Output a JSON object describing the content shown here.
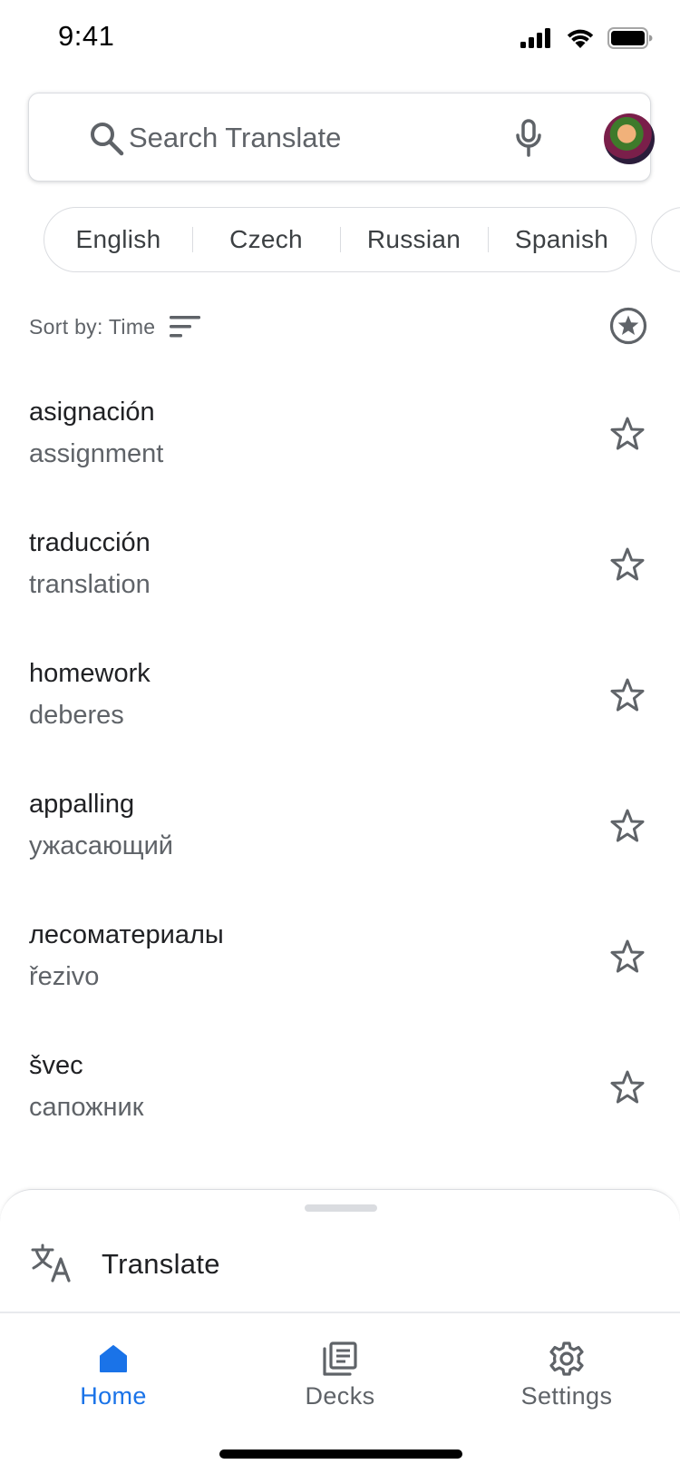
{
  "status_bar": {
    "time": "9:41"
  },
  "search": {
    "placeholder": "Search Translate"
  },
  "languages": [
    "English",
    "Czech",
    "Russian",
    "Spanish"
  ],
  "sort": {
    "label": "Sort by: Time"
  },
  "phrases": [
    {
      "source": "asignación",
      "target": "assignment"
    },
    {
      "source": "traducción",
      "target": "translation"
    },
    {
      "source": "homework",
      "target": "deberes"
    },
    {
      "source": "appalling",
      "target": "ужасающий"
    },
    {
      "source": "лесоматериалы",
      "target": "řezivo"
    },
    {
      "source": "švec",
      "target": "сапожник"
    }
  ],
  "sheet": {
    "translate_label": "Translate"
  },
  "nav": {
    "items": [
      {
        "label": "Home",
        "icon": "home-icon",
        "active": true
      },
      {
        "label": "Decks",
        "icon": "decks-icon",
        "active": false
      },
      {
        "label": "Settings",
        "icon": "gear-icon",
        "active": false
      }
    ]
  },
  "colors": {
    "accent": "#1a73e8",
    "icon_gray": "#5f6368",
    "divider": "#dadce0"
  }
}
